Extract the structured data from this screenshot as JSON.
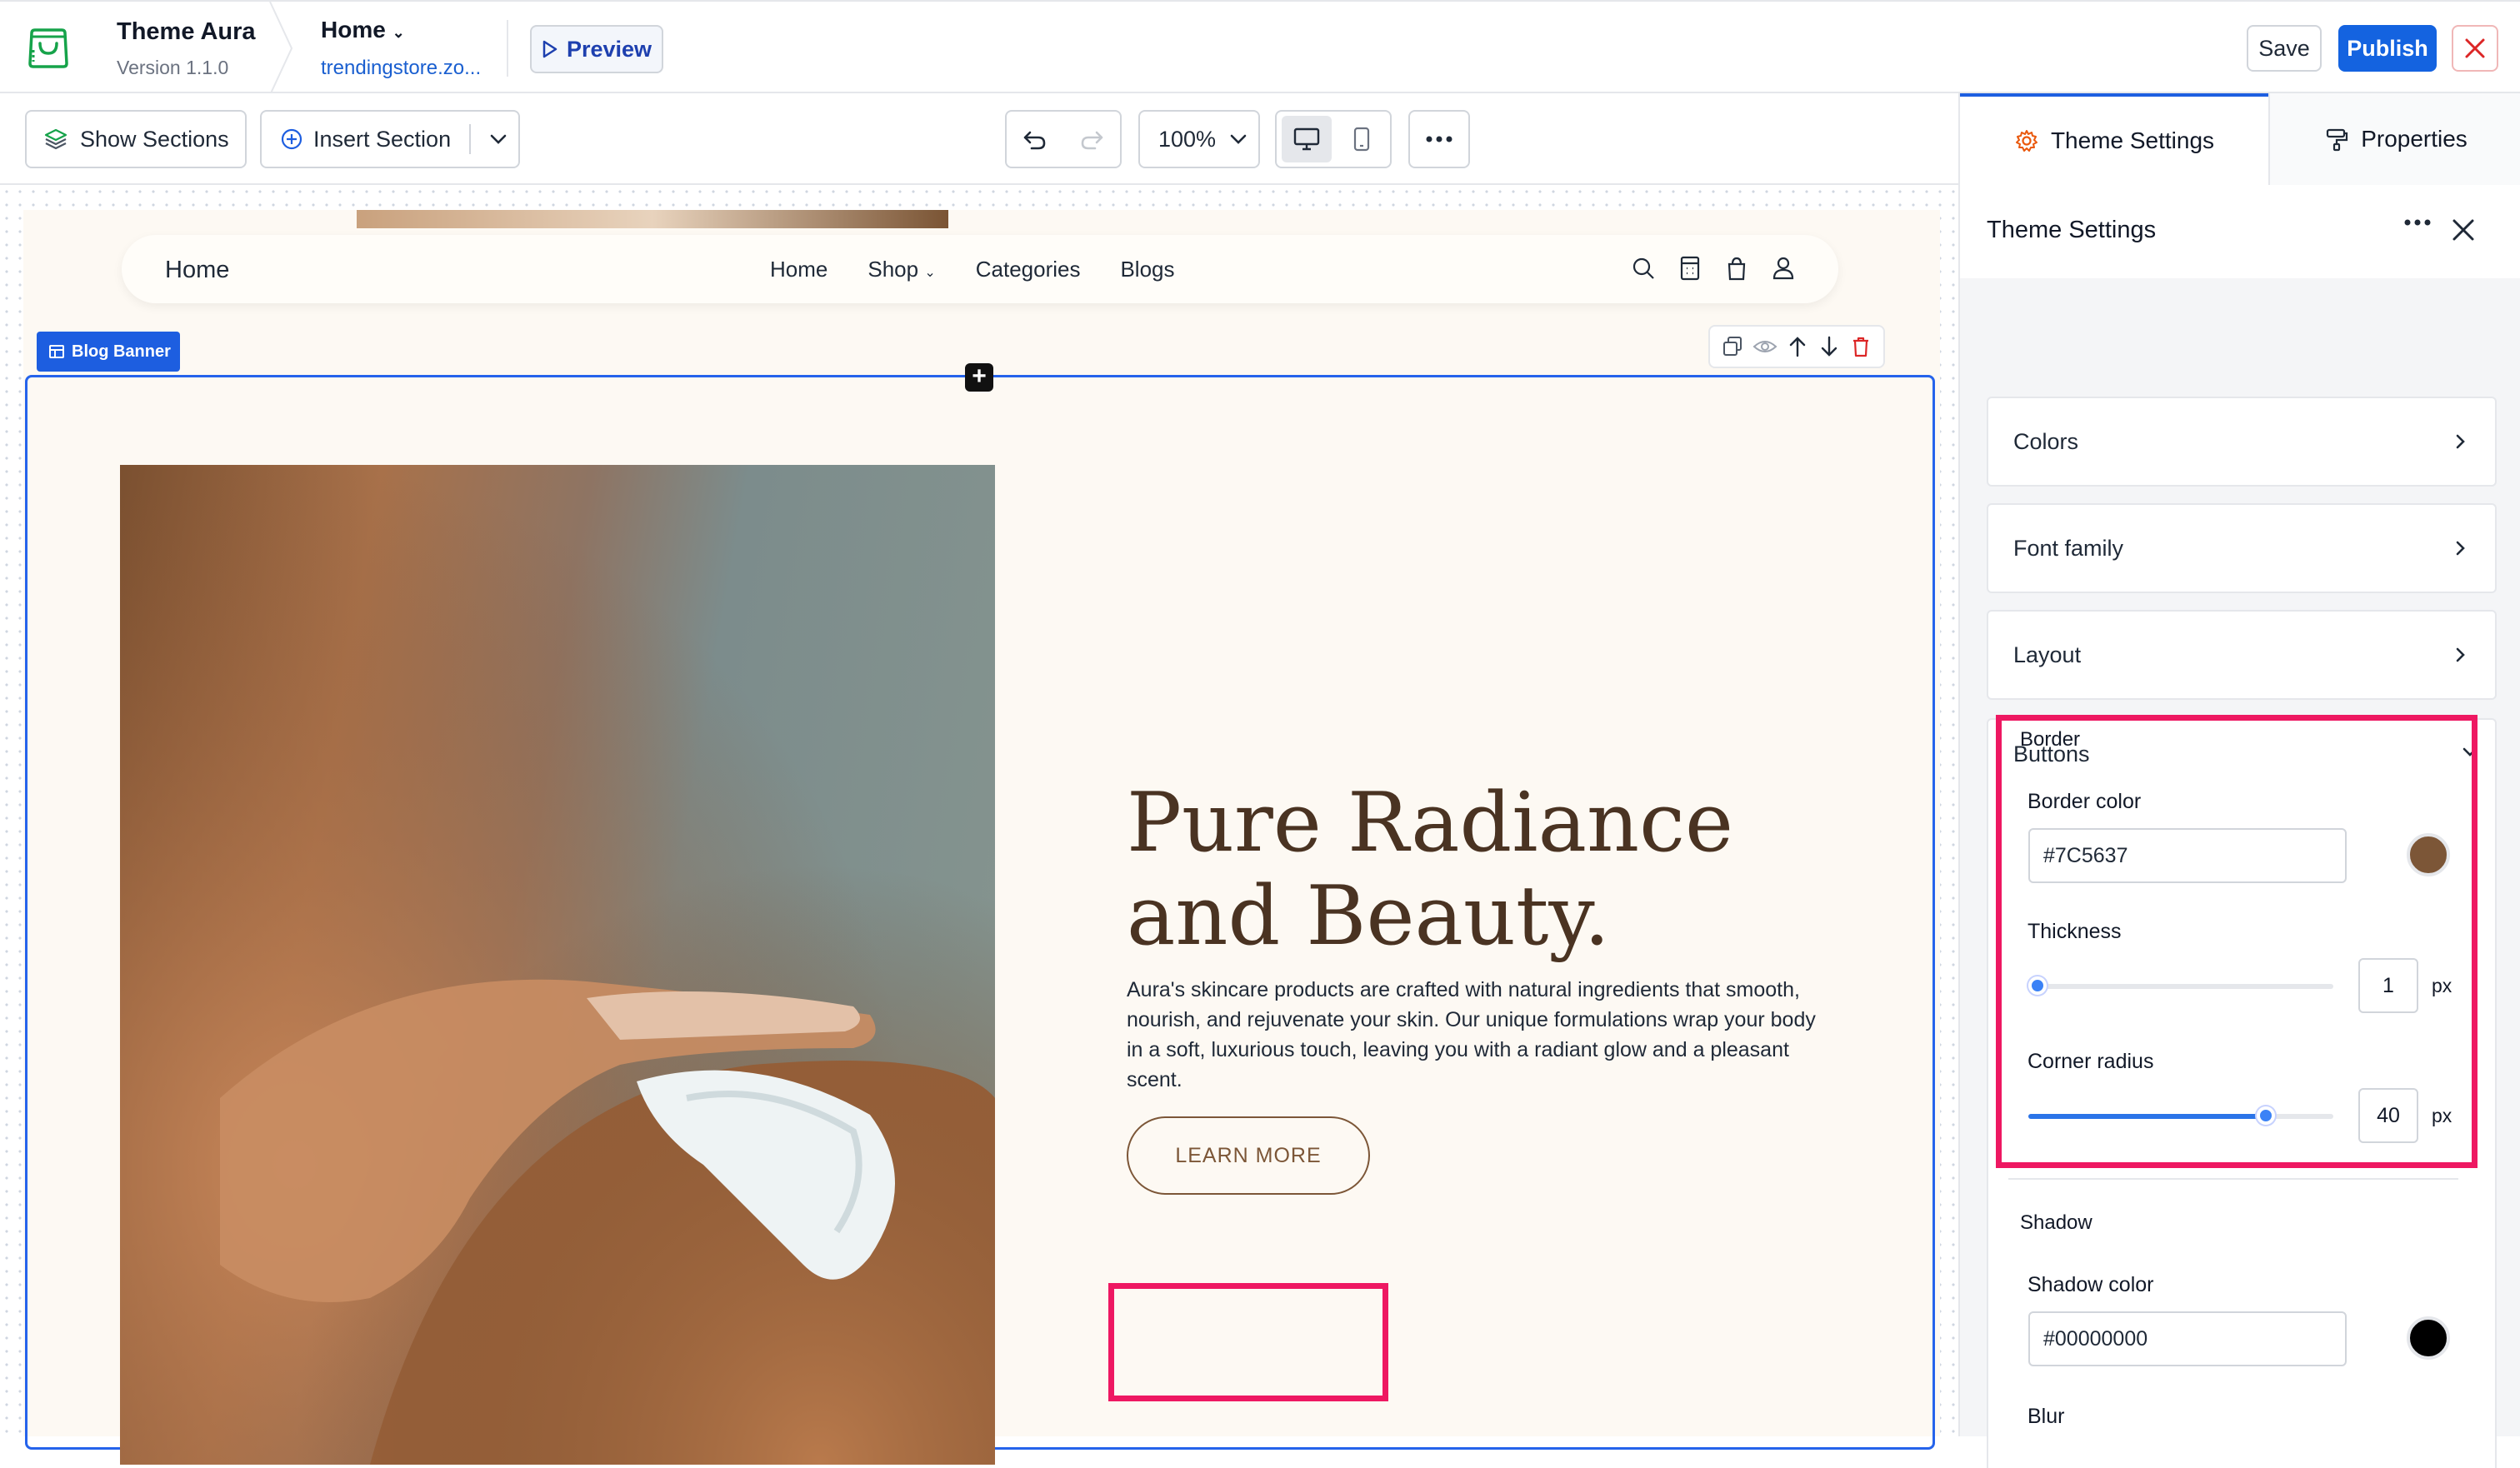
{
  "app": {
    "name": "Theme Aura",
    "version": "Version 1.1.0",
    "page": "Home",
    "url": "trendingstore.zo...",
    "preview": "Preview",
    "save": "Save",
    "publish": "Publish"
  },
  "toolbar": {
    "show_sections": "Show Sections",
    "insert_section": "Insert Section",
    "zoom": "100%"
  },
  "site": {
    "nav_brand": "Home",
    "nav_links": [
      "Home",
      "Shop",
      "Categories",
      "Blogs"
    ],
    "section_label": "Blog Banner",
    "hero_title": "Pure Radiance and Beauty.",
    "hero_body": "Aura's skincare products are crafted with natural ingredients that smooth, nourish, and rejuvenate your skin. Our unique formulations wrap your body in a soft, luxurious touch, leaving you with a radiant glow and a pleasant scent.",
    "cta": "LEARN MORE"
  },
  "panel": {
    "tabs": [
      "Theme Settings",
      "Properties"
    ],
    "title": "Theme Settings",
    "accordions": [
      "Colors",
      "Font family",
      "Layout",
      "Buttons"
    ],
    "border": {
      "heading": "Border",
      "color_label": "Border color",
      "color_value": "#7C5637",
      "thickness_label": "Thickness",
      "thickness_value": "1",
      "radius_label": "Corner radius",
      "radius_value": "40",
      "unit": "px"
    },
    "shadow": {
      "heading": "Shadow",
      "color_label": "Shadow color",
      "color_value": "#00000000",
      "blur_label": "Blur"
    }
  },
  "slider_levels": {
    "thickness": 0.03,
    "radius": 0.78
  },
  "colors": {
    "accent": "#1463e0",
    "brown": "#7c5637",
    "highlight": "#ee1862"
  }
}
